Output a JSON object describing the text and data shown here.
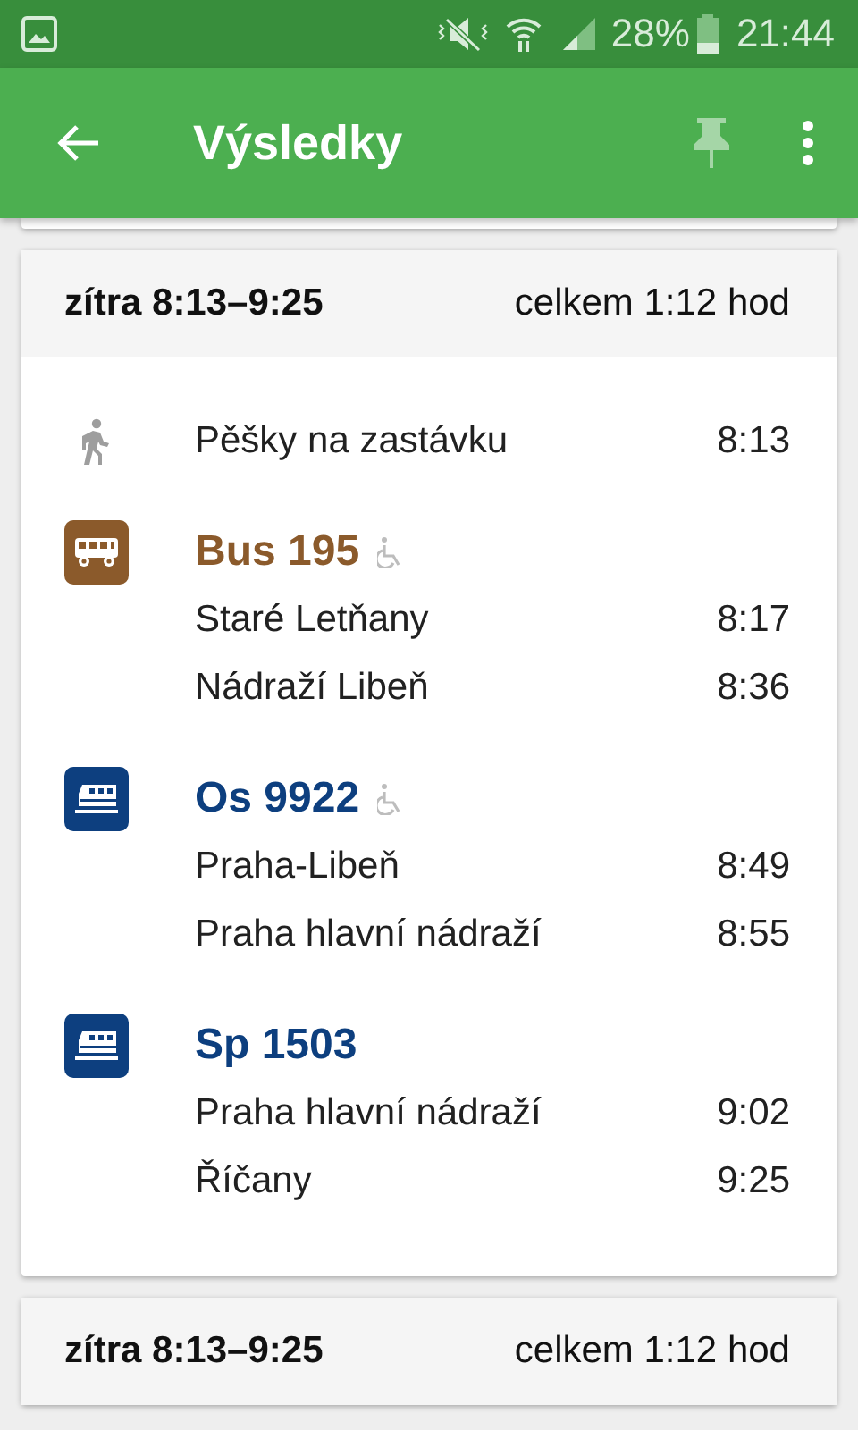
{
  "status_bar": {
    "battery": "28%",
    "time": "21:44"
  },
  "app_bar": {
    "title": "Výsledky"
  },
  "connections": [
    {
      "date_time": "zítra 8:13–9:25",
      "total": "celkem 1:12 hod",
      "legs": [
        {
          "kind": "walk",
          "text": "Pěšky na zastávku",
          "time": "8:13"
        },
        {
          "kind": "bus",
          "line": "Bus 195",
          "color": "#8b5a2b",
          "accessible": true,
          "stops": [
            {
              "name": "Staré Letňany",
              "time": "8:17"
            },
            {
              "name": "Nádraží Libeň",
              "time": "8:36"
            }
          ]
        },
        {
          "kind": "train",
          "line": "Os 9922",
          "color": "#0d3f7f",
          "accessible": true,
          "stops": [
            {
              "name": "Praha-Libeň",
              "time": "8:49"
            },
            {
              "name": "Praha hlavní nádraží",
              "time": "8:55"
            }
          ]
        },
        {
          "kind": "train",
          "line": "Sp 1503",
          "color": "#0d3f7f",
          "accessible": false,
          "stops": [
            {
              "name": "Praha hlavní nádraží",
              "time": "9:02"
            },
            {
              "name": "Říčany",
              "time": "9:25"
            }
          ]
        }
      ]
    },
    {
      "date_time": "zítra 8:13–9:25",
      "total": "celkem 1:12 hod"
    }
  ]
}
